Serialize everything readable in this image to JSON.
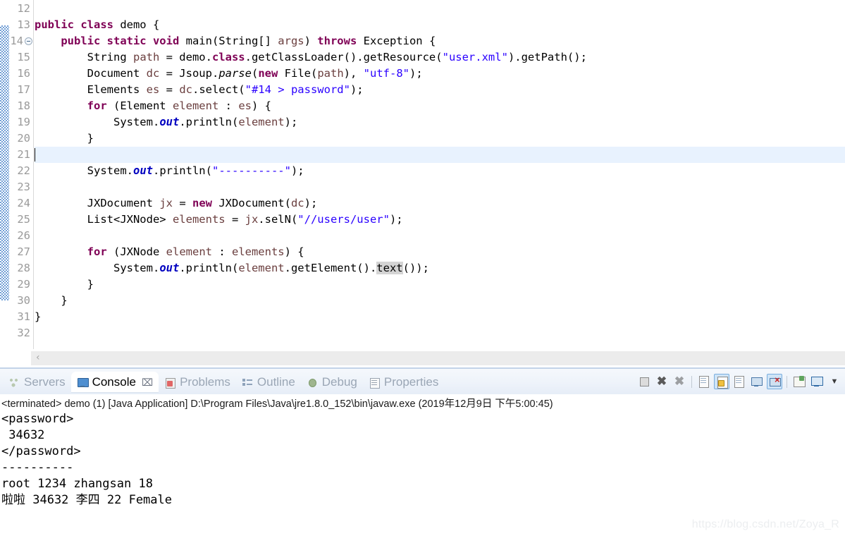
{
  "editor": {
    "first_visible_line": 12,
    "caret_line": 21,
    "occurrence_highlight": "text",
    "lines": [
      {
        "num": 12,
        "indent": 0,
        "html": ""
      },
      {
        "num": 13,
        "indent": 0,
        "html": "<span class=\"k\">public class</span> demo {"
      },
      {
        "num": 14,
        "fold": true,
        "html": "    <span class=\"k\">public static void</span> main(String[] <span class=\"lv\">args</span>) <span class=\"k\">throws</span> Exception {"
      },
      {
        "num": 15,
        "html": "        String <span class=\"lv\">path</span> = demo.<span class=\"k\">class</span>.getClassLoader().getResource(<span class=\"s\">\"user.xml\"</span>).getPath();"
      },
      {
        "num": 16,
        "html": "        Document <span class=\"lv\">dc</span> = Jsoup.<span class=\"st\">parse</span>(<span class=\"k\">new</span> File(<span class=\"lv\">path</span>), <span class=\"s\">\"utf-8\"</span>);"
      },
      {
        "num": 17,
        "html": "        Elements <span class=\"lv\">es</span> = <span class=\"lv\">dc</span>.select(<span class=\"s\">\"#14 &gt; password\"</span>);"
      },
      {
        "num": 18,
        "html": "        <span class=\"k\">for</span> (Element <span class=\"lv\">element</span> : <span class=\"lv\">es</span>) {"
      },
      {
        "num": 19,
        "html": "            System.<span class=\"fi\">out</span>.println(<span class=\"lv\">element</span>);"
      },
      {
        "num": 20,
        "html": "        }"
      },
      {
        "num": 21,
        "html": ""
      },
      {
        "num": 22,
        "html": "        System.<span class=\"fi\">out</span>.println(<span class=\"s\">\"----------\"</span>);"
      },
      {
        "num": 23,
        "html": ""
      },
      {
        "num": 24,
        "html": "        JXDocument <span class=\"lv\">jx</span> = <span class=\"k\">new</span> JXDocument(<span class=\"lv\">dc</span>);"
      },
      {
        "num": 25,
        "html": "        List&lt;JXNode&gt; <span class=\"lv\">elements</span> = <span class=\"lv\">jx</span>.selN(<span class=\"s\">\"//users/user\"</span>);"
      },
      {
        "num": 26,
        "html": ""
      },
      {
        "num": 27,
        "html": "        <span class=\"k\">for</span> (JXNode <span class=\"lv\">element</span> : <span class=\"lv\">elements</span>) {"
      },
      {
        "num": 28,
        "html": "            System.<span class=\"fi\">out</span>.println(<span class=\"lv\">element</span>.getElement().<span class=\"hl-occ\">text</span>());"
      },
      {
        "num": 29,
        "html": "        }"
      },
      {
        "num": 30,
        "html": "    }"
      },
      {
        "num": 31,
        "html": "}"
      },
      {
        "num": 32,
        "html": ""
      }
    ],
    "scrollbar": {
      "left_arrow": "‹"
    }
  },
  "bottom_panel": {
    "tabs": [
      {
        "label": "Servers",
        "icon": "servers-icon",
        "active": false,
        "closable": false
      },
      {
        "label": "Console",
        "icon": "console-icon",
        "active": true,
        "closable": true,
        "close_glyph": "⌧"
      },
      {
        "label": "Problems",
        "icon": "problems-icon",
        "active": false,
        "closable": false
      },
      {
        "label": "Outline",
        "icon": "outline-icon",
        "active": false,
        "closable": false
      },
      {
        "label": "Debug",
        "icon": "debug-icon",
        "active": false,
        "closable": false
      },
      {
        "label": "Properties",
        "icon": "properties-icon",
        "active": false,
        "closable": false
      }
    ],
    "toolbar": [
      {
        "name": "terminate-button",
        "glyph": "",
        "kind": "stop",
        "pressed": false
      },
      {
        "name": "remove-launch-button",
        "glyph": "✖",
        "kind": "x",
        "pressed": false
      },
      {
        "name": "remove-all-launches-button",
        "glyph": "✖",
        "kind": "xx",
        "pressed": false
      },
      {
        "name": "separator-1",
        "kind": "sep"
      },
      {
        "name": "clear-console-button",
        "kind": "doc",
        "pressed": false
      },
      {
        "name": "scroll-lock-button",
        "kind": "lock",
        "pressed": true
      },
      {
        "name": "word-wrap-button",
        "kind": "docwrap",
        "pressed": false
      },
      {
        "name": "show-console-on-output-button",
        "kind": "screen",
        "pressed": false
      },
      {
        "name": "show-console-on-error-button",
        "kind": "screenx",
        "pressed": true
      },
      {
        "name": "separator-2",
        "kind": "sep"
      },
      {
        "name": "open-console-button",
        "kind": "newcon",
        "pressed": false
      },
      {
        "name": "display-selected-console-button",
        "kind": "display",
        "pressed": false
      },
      {
        "name": "console-menu-dropdown",
        "kind": "caret",
        "glyph": "▼",
        "pressed": false
      }
    ],
    "console": {
      "terminated_line": "<terminated> demo (1) [Java Application] D:\\Program Files\\Java\\jre1.8.0_152\\bin\\javaw.exe (2019年12月9日 下午5:00:45)",
      "output_lines": [
        "<password>",
        " 34632",
        "</password>",
        "----------",
        "root 1234 zhangsan 18",
        "啦啦 34632 李四 22 Female"
      ]
    }
  },
  "watermark": {
    "text": "https://blog.csdn.net/Zoya_R"
  }
}
